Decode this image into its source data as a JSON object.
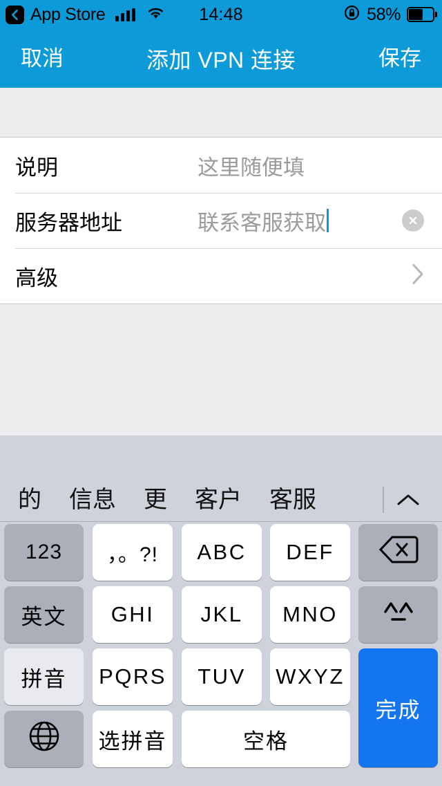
{
  "status_bar": {
    "back_app": "App Store",
    "back_icon": "chevron-left-icon",
    "signal_icon": "cellular-signal-icon",
    "signal_bars": 4,
    "wifi_icon": "wifi-icon",
    "time": "14:48",
    "rotation_lock_icon": "rotation-lock-icon",
    "battery_percent": "58%",
    "battery_level": 58
  },
  "nav_bar": {
    "cancel_label": "取消",
    "title": "添加 VPN 连接",
    "save_label": "保存",
    "bg_color": "#0c9ad9"
  },
  "form": {
    "rows": [
      {
        "label": "说明",
        "value": "这里随便填",
        "type": "text",
        "focused": false,
        "has_clear": false,
        "has_chevron": false
      },
      {
        "label": "服务器地址",
        "value": "联系客服获取",
        "type": "text",
        "focused": true,
        "has_clear": true,
        "clear_icon": "clear-circle-icon",
        "has_chevron": false
      },
      {
        "label": "高级",
        "value": "",
        "type": "disclosure",
        "focused": false,
        "has_clear": false,
        "has_chevron": true,
        "chevron_icon": "chevron-right-icon"
      }
    ]
  },
  "keyboard": {
    "predictions": [
      "的",
      "信息",
      "更",
      "客户",
      "客服"
    ],
    "expand_icon": "chevron-up-icon",
    "rows": [
      [
        {
          "label": "123",
          "name": "key-123",
          "style": "gray"
        },
        {
          "label": "，。?!",
          "name": "key-punctuation",
          "style": "white"
        },
        {
          "label": "ABC",
          "name": "key-abc",
          "style": "white"
        },
        {
          "label": "DEF",
          "name": "key-def",
          "style": "white"
        },
        {
          "label": "",
          "name": "key-backspace",
          "style": "gray",
          "icon": "backspace-icon"
        }
      ],
      [
        {
          "label": "英文",
          "name": "key-english",
          "style": "gray"
        },
        {
          "label": "GHI",
          "name": "key-ghi",
          "style": "white"
        },
        {
          "label": "JKL",
          "name": "key-jkl",
          "style": "white"
        },
        {
          "label": "MNO",
          "name": "key-mno",
          "style": "white"
        },
        {
          "label": "^^",
          "name": "key-emoticon",
          "style": "gray",
          "icon": "emoticon-icon"
        }
      ],
      [
        {
          "label": "拼音",
          "name": "key-pinyin",
          "style": "light"
        },
        {
          "label": "PQRS",
          "name": "key-pqrs",
          "style": "white"
        },
        {
          "label": "TUV",
          "name": "key-tuv",
          "style": "white"
        },
        {
          "label": "WXYZ",
          "name": "key-wxyz",
          "style": "white"
        },
        {
          "label": "完成",
          "name": "key-done",
          "style": "blue"
        }
      ],
      [
        {
          "label": "",
          "name": "key-globe",
          "style": "gray",
          "icon": "globe-icon"
        },
        {
          "label": "选拼音",
          "name": "key-select-pinyin",
          "style": "white"
        },
        {
          "label": "空格",
          "name": "key-space",
          "style": "white"
        }
      ]
    ],
    "done_label": "完成",
    "accent_color": "#1376f0"
  }
}
